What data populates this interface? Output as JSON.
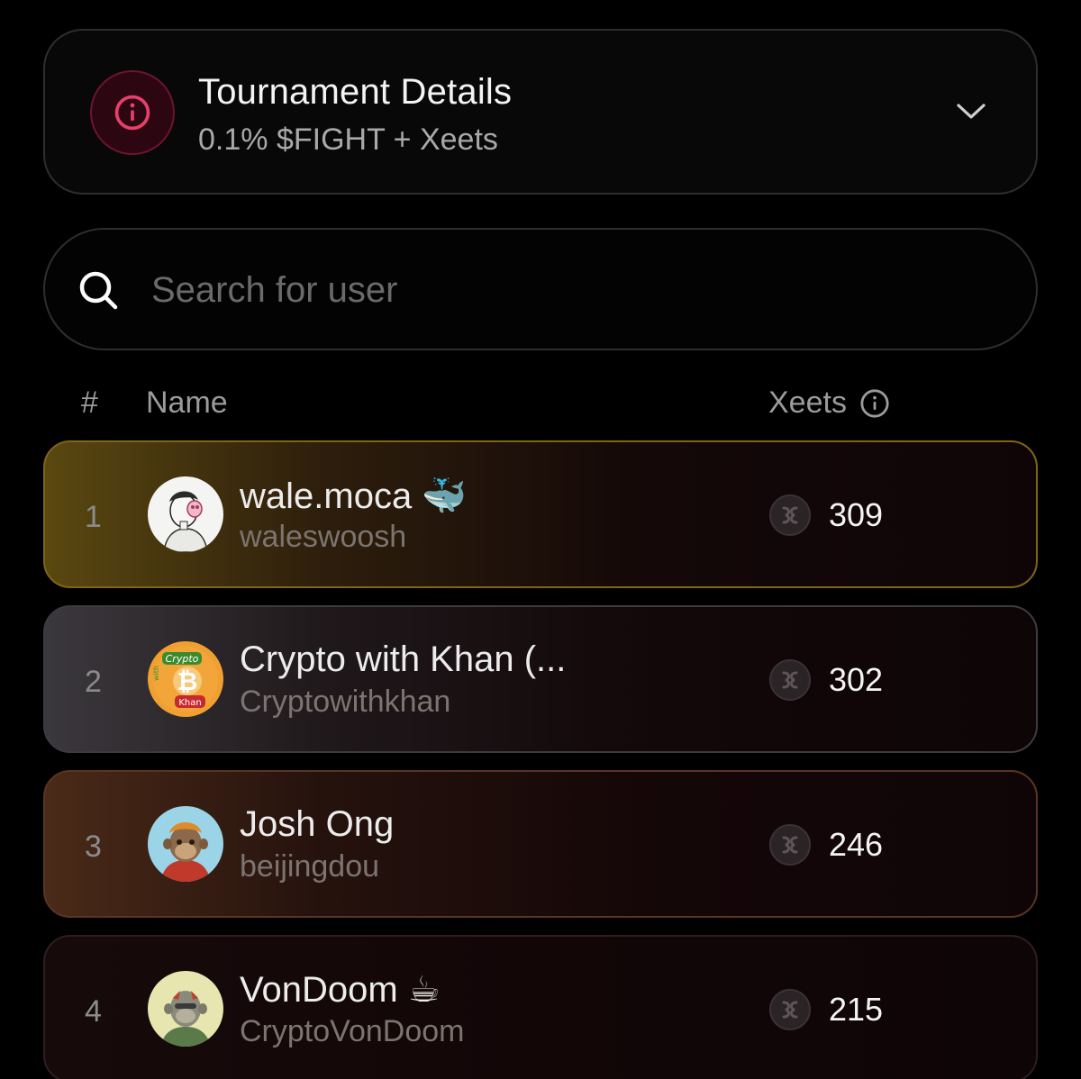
{
  "details": {
    "title": "Tournament Details",
    "subtitle": "0.1% $FIGHT + Xeets",
    "icon": "info-icon",
    "accent": "#e0315f"
  },
  "search": {
    "placeholder": "Search for user",
    "value": ""
  },
  "table": {
    "headers": {
      "rank": "#",
      "name": "Name",
      "xeets": "Xeets"
    },
    "rows": [
      {
        "rank": "1",
        "name": "wale.moca 🐳",
        "handle": "waleswoosh",
        "xeets": "309",
        "theme": "gold"
      },
      {
        "rank": "2",
        "name": "Crypto with Khan (...",
        "handle": "Cryptowithkhan",
        "xeets": "302",
        "theme": "silver"
      },
      {
        "rank": "3",
        "name": "Josh Ong",
        "handle": "beijingdou",
        "xeets": "246",
        "theme": "bronze"
      },
      {
        "rank": "4",
        "name": "VonDoom ☕",
        "handle": "CryptoVonDoom",
        "xeets": "215",
        "theme": "default"
      }
    ],
    "avatar_texts": {
      "khan_top": "Crypto",
      "khan_side": "with",
      "khan_bottom": "Khan"
    }
  }
}
